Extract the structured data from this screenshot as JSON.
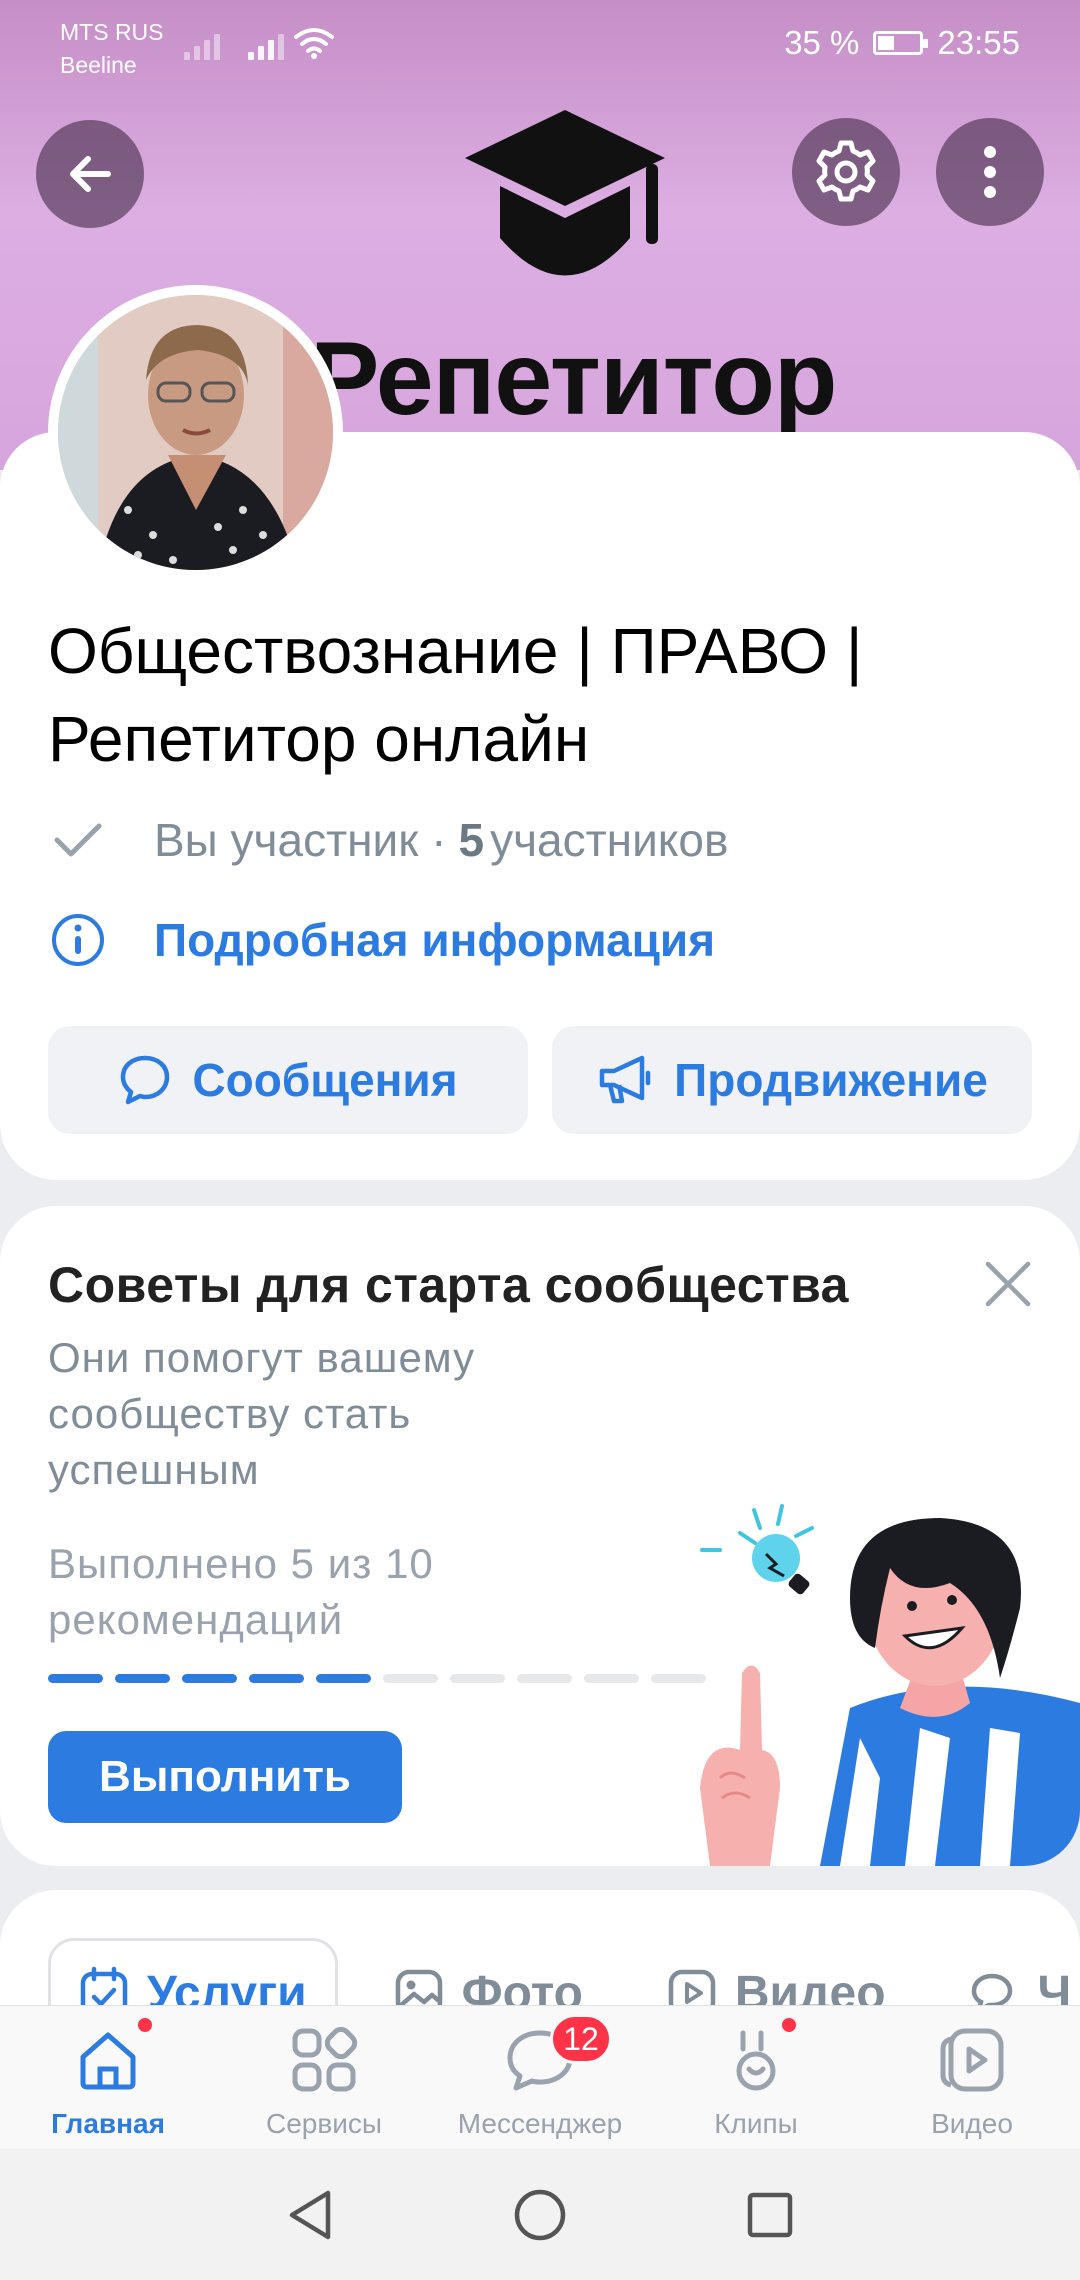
{
  "status_bar": {
    "carrier1": "MTS RUS",
    "carrier2": "Beeline",
    "battery": "35 %",
    "time": "23:55"
  },
  "cover": {
    "title": "Репетитор",
    "back_icon": "arrow-left-icon",
    "settings_icon": "gear-icon",
    "more_icon": "more-vertical-icon",
    "logo_icon": "graduation-cap-icon"
  },
  "group": {
    "name": "Обществознание | ПРАВО | Репетитор онлайн",
    "member_status": "Вы участник ·",
    "member_count": "5",
    "member_suffix": "участников",
    "info_link": "Подробная информация",
    "messages_button": "Сообщения",
    "promotion_button": "Продвижение"
  },
  "tips": {
    "title": "Советы для старта сообщества",
    "subtitle": "Они помогут вашему сообществу стать успешным",
    "progress_text": "Выполнено 5 из 10 рекомендаций",
    "progress_done": 5,
    "progress_total": 10,
    "action_button": "Выполнить"
  },
  "tabs": [
    {
      "label": "Услуги",
      "icon": "calendar-check-icon",
      "active": true
    },
    {
      "label": "Фото",
      "icon": "image-icon",
      "active": false
    },
    {
      "label": "Видео",
      "icon": "play-icon",
      "active": false
    },
    {
      "label": "Ч",
      "icon": "chat-icon",
      "active": false
    }
  ],
  "bottom_nav": [
    {
      "label": "Главная",
      "icon": "home-icon",
      "active": true,
      "dot": true
    },
    {
      "label": "Сервисы",
      "icon": "services-grid-icon",
      "active": false
    },
    {
      "label": "Мессенджер",
      "icon": "messenger-icon",
      "active": false,
      "badge": "12"
    },
    {
      "label": "Клипы",
      "icon": "clips-icon",
      "active": false,
      "dot": true
    },
    {
      "label": "Видео",
      "icon": "video-icon",
      "active": false
    }
  ],
  "colors": {
    "accent": "#2c7be0",
    "cover": "#d7a5dd",
    "badge": "#ff3347"
  }
}
